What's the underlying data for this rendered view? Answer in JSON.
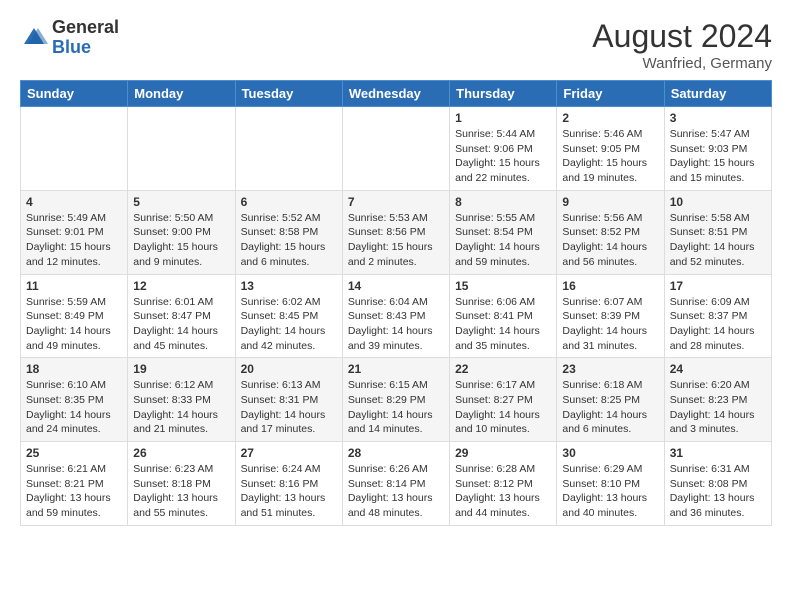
{
  "header": {
    "logo_general": "General",
    "logo_blue": "Blue",
    "month_year": "August 2024",
    "location": "Wanfried, Germany"
  },
  "days_of_week": [
    "Sunday",
    "Monday",
    "Tuesday",
    "Wednesday",
    "Thursday",
    "Friday",
    "Saturday"
  ],
  "weeks": [
    [
      {
        "day": "",
        "info": ""
      },
      {
        "day": "",
        "info": ""
      },
      {
        "day": "",
        "info": ""
      },
      {
        "day": "",
        "info": ""
      },
      {
        "day": "1",
        "info": "Sunrise: 5:44 AM\nSunset: 9:06 PM\nDaylight: 15 hours and 22 minutes."
      },
      {
        "day": "2",
        "info": "Sunrise: 5:46 AM\nSunset: 9:05 PM\nDaylight: 15 hours and 19 minutes."
      },
      {
        "day": "3",
        "info": "Sunrise: 5:47 AM\nSunset: 9:03 PM\nDaylight: 15 hours and 15 minutes."
      }
    ],
    [
      {
        "day": "4",
        "info": "Sunrise: 5:49 AM\nSunset: 9:01 PM\nDaylight: 15 hours and 12 minutes."
      },
      {
        "day": "5",
        "info": "Sunrise: 5:50 AM\nSunset: 9:00 PM\nDaylight: 15 hours and 9 minutes."
      },
      {
        "day": "6",
        "info": "Sunrise: 5:52 AM\nSunset: 8:58 PM\nDaylight: 15 hours and 6 minutes."
      },
      {
        "day": "7",
        "info": "Sunrise: 5:53 AM\nSunset: 8:56 PM\nDaylight: 15 hours and 2 minutes."
      },
      {
        "day": "8",
        "info": "Sunrise: 5:55 AM\nSunset: 8:54 PM\nDaylight: 14 hours and 59 minutes."
      },
      {
        "day": "9",
        "info": "Sunrise: 5:56 AM\nSunset: 8:52 PM\nDaylight: 14 hours and 56 minutes."
      },
      {
        "day": "10",
        "info": "Sunrise: 5:58 AM\nSunset: 8:51 PM\nDaylight: 14 hours and 52 minutes."
      }
    ],
    [
      {
        "day": "11",
        "info": "Sunrise: 5:59 AM\nSunset: 8:49 PM\nDaylight: 14 hours and 49 minutes."
      },
      {
        "day": "12",
        "info": "Sunrise: 6:01 AM\nSunset: 8:47 PM\nDaylight: 14 hours and 45 minutes."
      },
      {
        "day": "13",
        "info": "Sunrise: 6:02 AM\nSunset: 8:45 PM\nDaylight: 14 hours and 42 minutes."
      },
      {
        "day": "14",
        "info": "Sunrise: 6:04 AM\nSunset: 8:43 PM\nDaylight: 14 hours and 39 minutes."
      },
      {
        "day": "15",
        "info": "Sunrise: 6:06 AM\nSunset: 8:41 PM\nDaylight: 14 hours and 35 minutes."
      },
      {
        "day": "16",
        "info": "Sunrise: 6:07 AM\nSunset: 8:39 PM\nDaylight: 14 hours and 31 minutes."
      },
      {
        "day": "17",
        "info": "Sunrise: 6:09 AM\nSunset: 8:37 PM\nDaylight: 14 hours and 28 minutes."
      }
    ],
    [
      {
        "day": "18",
        "info": "Sunrise: 6:10 AM\nSunset: 8:35 PM\nDaylight: 14 hours and 24 minutes."
      },
      {
        "day": "19",
        "info": "Sunrise: 6:12 AM\nSunset: 8:33 PM\nDaylight: 14 hours and 21 minutes."
      },
      {
        "day": "20",
        "info": "Sunrise: 6:13 AM\nSunset: 8:31 PM\nDaylight: 14 hours and 17 minutes."
      },
      {
        "day": "21",
        "info": "Sunrise: 6:15 AM\nSunset: 8:29 PM\nDaylight: 14 hours and 14 minutes."
      },
      {
        "day": "22",
        "info": "Sunrise: 6:17 AM\nSunset: 8:27 PM\nDaylight: 14 hours and 10 minutes."
      },
      {
        "day": "23",
        "info": "Sunrise: 6:18 AM\nSunset: 8:25 PM\nDaylight: 14 hours and 6 minutes."
      },
      {
        "day": "24",
        "info": "Sunrise: 6:20 AM\nSunset: 8:23 PM\nDaylight: 14 hours and 3 minutes."
      }
    ],
    [
      {
        "day": "25",
        "info": "Sunrise: 6:21 AM\nSunset: 8:21 PM\nDaylight: 13 hours and 59 minutes."
      },
      {
        "day": "26",
        "info": "Sunrise: 6:23 AM\nSunset: 8:18 PM\nDaylight: 13 hours and 55 minutes."
      },
      {
        "day": "27",
        "info": "Sunrise: 6:24 AM\nSunset: 8:16 PM\nDaylight: 13 hours and 51 minutes."
      },
      {
        "day": "28",
        "info": "Sunrise: 6:26 AM\nSunset: 8:14 PM\nDaylight: 13 hours and 48 minutes."
      },
      {
        "day": "29",
        "info": "Sunrise: 6:28 AM\nSunset: 8:12 PM\nDaylight: 13 hours and 44 minutes."
      },
      {
        "day": "30",
        "info": "Sunrise: 6:29 AM\nSunset: 8:10 PM\nDaylight: 13 hours and 40 minutes."
      },
      {
        "day": "31",
        "info": "Sunrise: 6:31 AM\nSunset: 8:08 PM\nDaylight: 13 hours and 36 minutes."
      }
    ]
  ]
}
